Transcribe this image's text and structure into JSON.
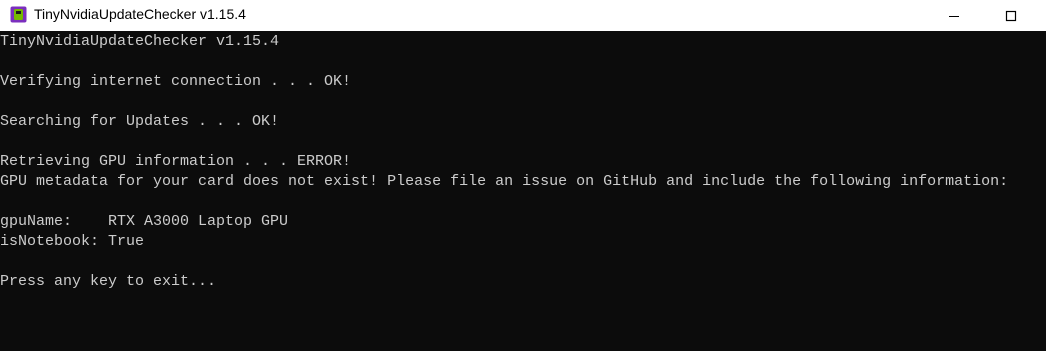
{
  "window": {
    "title": "TinyNvidiaUpdateChecker v1.15.4",
    "icon": "app-icon"
  },
  "controls": {
    "minimize": "minimize-icon",
    "maximize": "maximize-icon"
  },
  "colors": {
    "console_bg": "#0c0c0c",
    "console_text": "#cccccc",
    "titlebar_bg": "#ffffff",
    "icon_body": "#7b2fbe",
    "icon_accent": "#76b900"
  },
  "console": {
    "lines": [
      "TinyNvidiaUpdateChecker v1.15.4",
      "",
      "Verifying internet connection . . . OK!",
      "",
      "Searching for Updates . . . OK!",
      "",
      "Retrieving GPU information . . . ERROR!",
      "GPU metadata for your card does not exist! Please file an issue on GitHub and include the following information:",
      "",
      "gpuName:    RTX A3000 Laptop GPU",
      "isNotebook: True",
      "",
      "Press any key to exit..."
    ]
  }
}
